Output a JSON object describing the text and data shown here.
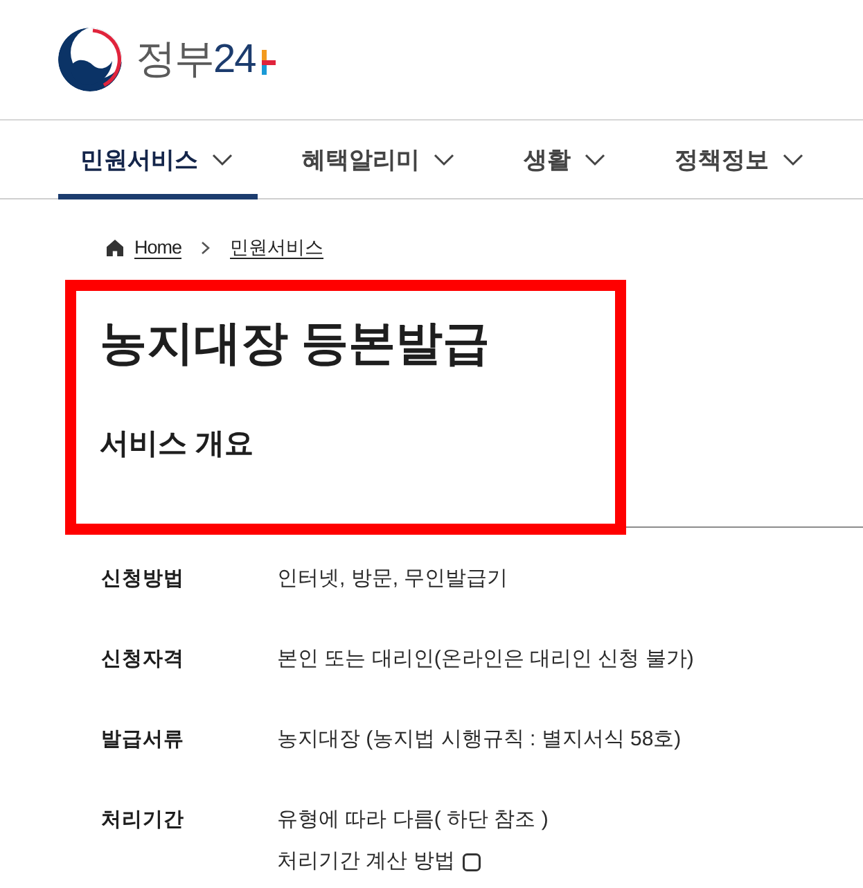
{
  "logo": {
    "title": "정부",
    "number": "24"
  },
  "nav": [
    {
      "label": "민원서비스",
      "selected": true
    },
    {
      "label": "혜택알리미",
      "selected": false
    },
    {
      "label": "생활",
      "selected": false
    },
    {
      "label": "정책정보",
      "selected": false
    }
  ],
  "breadcrumb": [
    {
      "kind": "home",
      "label": "Home"
    },
    {
      "kind": "link",
      "label": "민원서비스"
    }
  ],
  "overview": {
    "title": "농지대장 등본발급",
    "subtitle": "서비스 개요",
    "highlighted": true
  },
  "details": [
    {
      "label": "신청방법",
      "value": "인터넷, 방문, 무인발급기"
    },
    {
      "label": "신청자격",
      "value": "본인 또는 대리인(온라인은 대리인 신청 불가)"
    },
    {
      "label": "발급서류",
      "value": "농지대장 (농지법 시행규칙 : 별지서식 58호)"
    },
    {
      "label": "처리기간",
      "value": "유형에 따라 다름( 하단 참조 )",
      "note": "처리기간 계산 방법"
    }
  ]
}
